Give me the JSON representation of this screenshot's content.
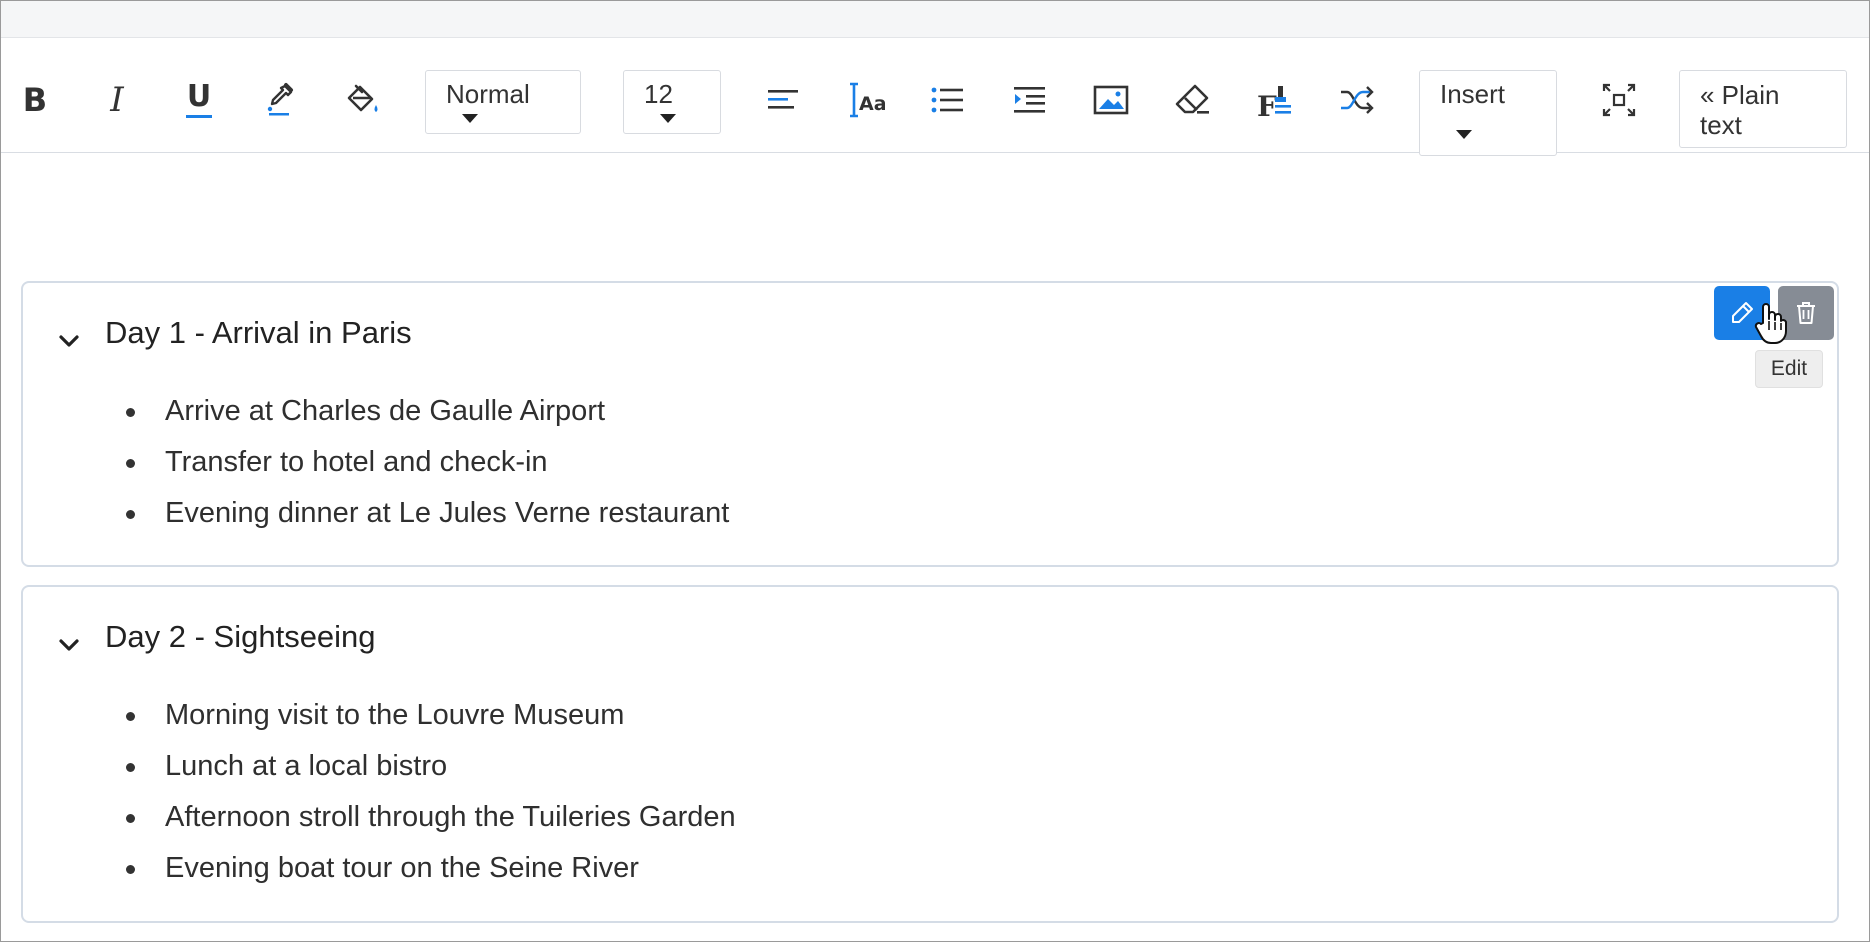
{
  "toolbar": {
    "icons": [
      {
        "name": "bold-icon",
        "glyph": "B"
      },
      {
        "name": "italic-icon",
        "glyph": "I"
      },
      {
        "name": "underline-icon",
        "glyph": "U"
      },
      {
        "name": "text-color-icon"
      },
      {
        "name": "background-color-icon"
      },
      {
        "name": "align-left-icon"
      },
      {
        "name": "text-case-icon"
      },
      {
        "name": "bulleted-list-icon"
      },
      {
        "name": "indent-icon"
      },
      {
        "name": "image-icon"
      },
      {
        "name": "eraser-icon"
      },
      {
        "name": "format-painter-icon"
      },
      {
        "name": "shuffle-icon"
      },
      {
        "name": "fullscreen-icon"
      }
    ],
    "style_select": {
      "value": "Normal"
    },
    "size_select": {
      "value": "12"
    },
    "insert_select": {
      "value": "Insert"
    },
    "plain_text_button": {
      "label": "« Plain text"
    }
  },
  "cards": [
    {
      "title": "Day 1 - Arrival in Paris",
      "items": [
        "Arrive at Charles de Gaulle Airport",
        "Transfer to hotel and check-in",
        "Evening dinner at Le Jules Verne restaurant"
      ]
    },
    {
      "title": "Day 2 - Sightseeing",
      "items": [
        "Morning visit to the Louvre Museum",
        "Lunch at a local bistro",
        "Afternoon stroll through the Tuileries Garden",
        "Evening boat tour on the Seine River"
      ]
    }
  ],
  "card_actions": {
    "edit_icon": "pencil-icon",
    "delete_icon": "trash-icon",
    "tooltip": "Edit"
  },
  "colors": {
    "accent": "#1a7fe6",
    "icon_dark": "#333333",
    "delete_button": "#868c95",
    "card_border": "#d4dce6"
  }
}
